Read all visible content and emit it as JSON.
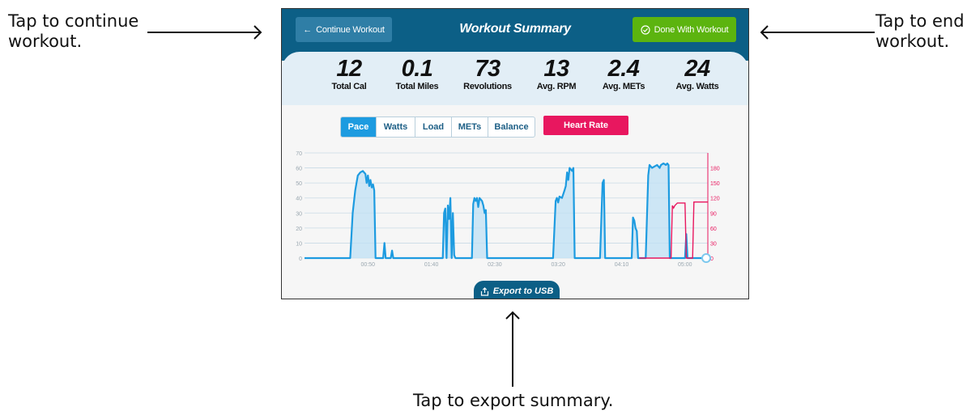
{
  "callouts": {
    "continue": "Tap to continue\nworkout.",
    "end": "Tap to end\nworkout.",
    "export": "Tap to export summary."
  },
  "header": {
    "continue_label": "Continue Workout",
    "title": "Workout Summary",
    "done_label": "Done With Workout"
  },
  "stats": [
    {
      "value": "12",
      "label": "Total Cal"
    },
    {
      "value": "0.1",
      "label": "Total Miles"
    },
    {
      "value": "73",
      "label": "Revolutions"
    },
    {
      "value": "13",
      "label": "Avg. RPM"
    },
    {
      "value": "2.4",
      "label": "Avg. METs"
    },
    {
      "value": "24",
      "label": "Avg. Watts"
    }
  ],
  "tabs": [
    "Pace",
    "Watts",
    "Load",
    "METs",
    "Balance"
  ],
  "active_tab": "Pace",
  "heart_rate_label": "Heart Rate",
  "export_label": "Export to USB",
  "colors": {
    "header": "#0c5f86",
    "done": "#5cb40f",
    "pace": "#1d9be0",
    "heart_rate": "#e8175f"
  },
  "chart_data": {
    "type": "line",
    "x_ticks": [
      "00:50",
      "01:40",
      "02:30",
      "03:20",
      "04:10",
      "05:00"
    ],
    "x_tick_seconds": [
      50,
      100,
      150,
      200,
      250,
      300
    ],
    "ylim_left": [
      0,
      70
    ],
    "y_ticks_left": [
      0,
      10,
      20,
      30,
      40,
      50,
      60,
      70
    ],
    "ylim_right": [
      0,
      210
    ],
    "y_ticks_right": [
      0,
      30,
      60,
      90,
      120,
      150,
      180
    ],
    "series": [
      {
        "axis": "left",
        "points": [
          [
            0,
            0
          ],
          [
            36,
            0
          ],
          [
            38,
            30
          ],
          [
            40,
            45
          ],
          [
            42,
            55
          ],
          [
            44,
            57
          ],
          [
            46,
            58
          ],
          [
            48,
            56
          ],
          [
            49,
            50
          ],
          [
            50,
            55
          ],
          [
            51,
            48
          ],
          [
            52,
            52
          ],
          [
            53,
            47
          ],
          [
            54,
            49
          ],
          [
            55,
            45
          ],
          [
            56,
            0
          ],
          [
            62,
            0
          ],
          [
            63,
            10
          ],
          [
            64,
            0
          ],
          [
            68,
            0
          ],
          [
            69,
            5
          ],
          [
            70,
            0
          ],
          [
            109,
            0
          ],
          [
            110,
            30
          ],
          [
            111,
            33
          ],
          [
            112,
            0
          ],
          [
            113,
            35
          ],
          [
            114,
            26
          ],
          [
            115,
            40
          ],
          [
            116,
            0
          ],
          [
            117,
            30
          ],
          [
            118,
            2
          ],
          [
            119,
            0
          ],
          [
            132,
            0
          ],
          [
            133,
            36
          ],
          [
            134,
            40
          ],
          [
            135,
            38
          ],
          [
            136,
            40
          ],
          [
            137,
            34
          ],
          [
            138,
            40
          ],
          [
            140,
            38
          ],
          [
            141,
            35
          ],
          [
            142,
            30
          ],
          [
            143,
            32
          ],
          [
            144,
            0
          ],
          [
            196,
            0
          ],
          [
            198,
            38
          ],
          [
            199,
            40
          ],
          [
            200,
            37
          ],
          [
            201,
            41
          ],
          [
            203,
            40
          ],
          [
            205,
            45
          ],
          [
            206,
            48
          ],
          [
            207,
            57
          ],
          [
            208,
            52
          ],
          [
            209,
            60
          ],
          [
            211,
            58
          ],
          [
            212,
            60
          ],
          [
            213,
            0
          ],
          [
            233,
            0
          ],
          [
            235,
            50
          ],
          [
            236,
            52
          ],
          [
            237,
            0
          ],
          [
            258,
            0
          ],
          [
            259,
            27
          ],
          [
            260,
            25
          ],
          [
            261,
            20
          ],
          [
            262,
            18
          ],
          [
            263,
            0
          ],
          [
            269,
            0
          ],
          [
            271,
            55
          ],
          [
            272,
            62
          ],
          [
            274,
            60
          ],
          [
            276,
            61
          ],
          [
            278,
            62
          ],
          [
            280,
            60
          ],
          [
            281,
            62
          ],
          [
            283,
            63
          ],
          [
            285,
            62
          ],
          [
            286,
            63
          ],
          [
            287,
            62
          ],
          [
            288,
            0
          ],
          [
            300,
            0
          ],
          [
            301,
            16
          ],
          [
            302,
            0
          ],
          [
            318,
            0
          ]
        ]
      },
      {
        "axis": "right",
        "points": [
          [
            264,
            0
          ],
          [
            289,
            0
          ],
          [
            290,
            105
          ],
          [
            291,
            100
          ],
          [
            292,
            105
          ],
          [
            294,
            110
          ],
          [
            296,
            110
          ],
          [
            298,
            110
          ],
          [
            300,
            110
          ],
          [
            301,
            0
          ],
          [
            306,
            0
          ],
          [
            307,
            112
          ],
          [
            318,
            112
          ]
        ]
      }
    ]
  }
}
